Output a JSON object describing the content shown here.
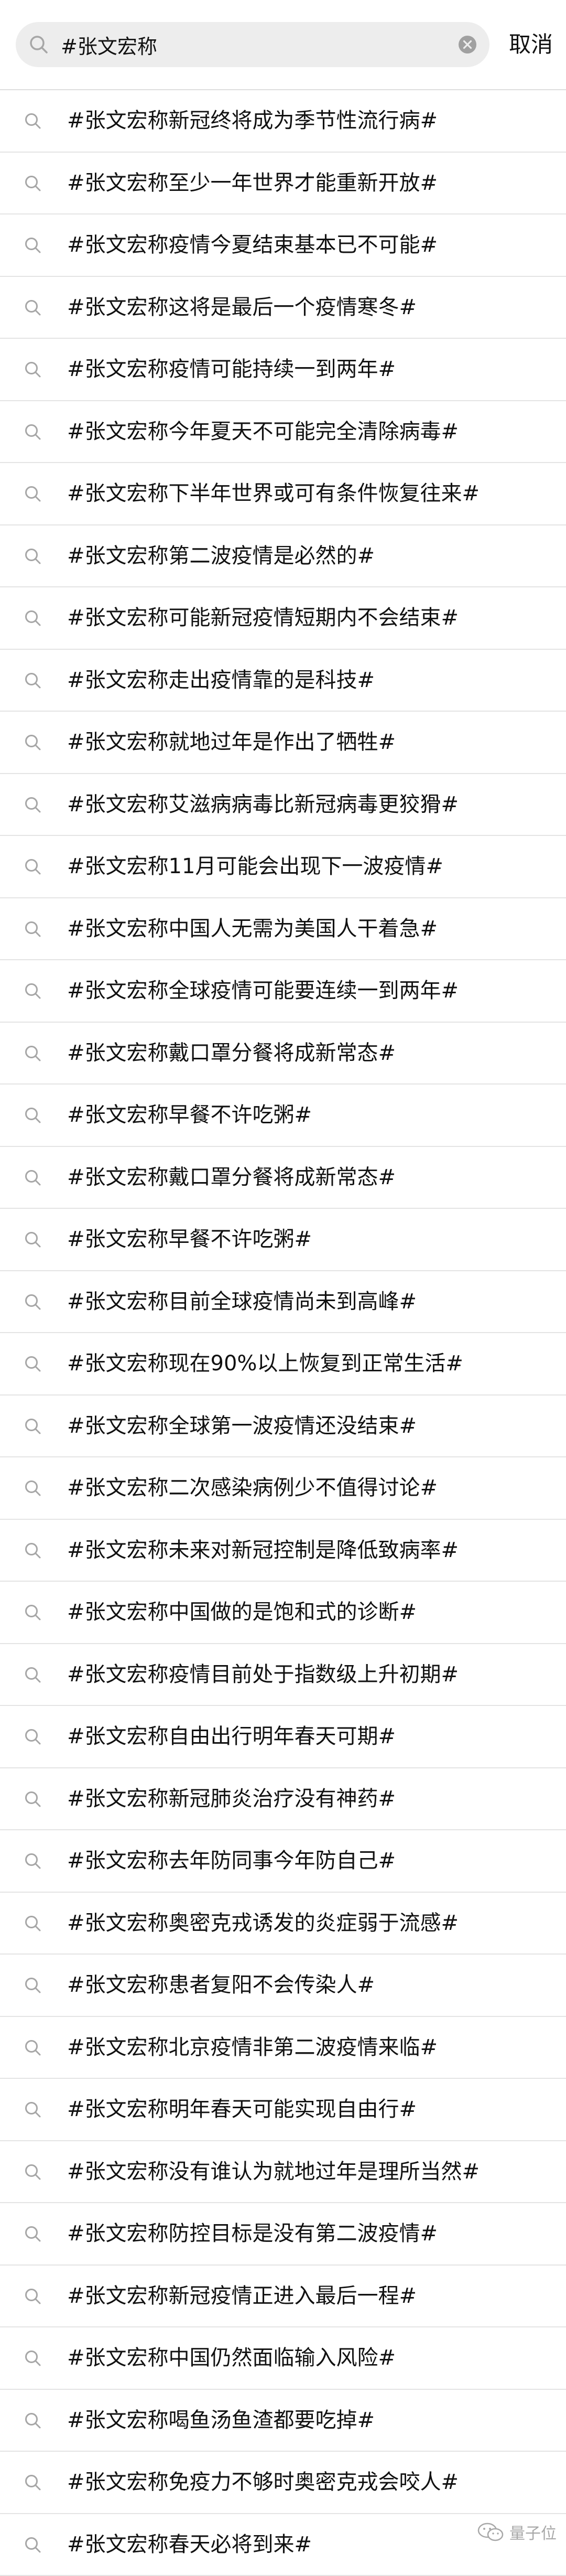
{
  "search": {
    "value": "#张文宏称",
    "cancel_label": "取消"
  },
  "results": [
    "#张文宏称新冠终将成为季节性流行病#",
    "#张文宏称至少一年世界才能重新开放#",
    "#张文宏称疫情今夏结束基本已不可能#",
    "#张文宏称这将是最后一个疫情寒冬#",
    "#张文宏称疫情可能持续一到两年#",
    "#张文宏称今年夏天不可能完全清除病毒#",
    "#张文宏称下半年世界或可有条件恢复往来#",
    "#张文宏称第二波疫情是必然的#",
    "#张文宏称可能新冠疫情短期内不会结束#",
    "#张文宏称走出疫情靠的是科技#",
    "#张文宏称就地过年是作出了牺牲#",
    "#张文宏称艾滋病病毒比新冠病毒更狡猾#",
    "#张文宏称11月可能会出现下一波疫情#",
    "#张文宏称中国人无需为美国人干着急#",
    "#张文宏称全球疫情可能要连续一到两年#",
    "#张文宏称戴口罩分餐将成新常态#",
    "#张文宏称早餐不许吃粥#",
    "#张文宏称戴口罩分餐将成新常态#",
    "#张文宏称早餐不许吃粥#",
    "#张文宏称目前全球疫情尚未到高峰#",
    "#张文宏称现在90%以上恢复到正常生活#",
    "#张文宏称全球第一波疫情还没结束#",
    "#张文宏称二次感染病例少不值得讨论#",
    "#张文宏称未来对新冠控制是降低致病率#",
    "#张文宏称中国做的是饱和式的诊断#",
    "#张文宏称疫情目前处于指数级上升初期#",
    "#张文宏称自由出行明年春天可期#",
    "#张文宏称新冠肺炎治疗没有神药#",
    "#张文宏称去年防同事今年防自己#",
    "#张文宏称奥密克戎诱发的炎症弱于流感#",
    "#张文宏称患者复阳不会传染人#",
    "#张文宏称北京疫情非第二波疫情来临#",
    "#张文宏称明年春天可能实现自由行#",
    "#张文宏称没有谁认为就地过年是理所当然#",
    "#张文宏称防控目标是没有第二波疫情#",
    "#张文宏称新冠疫情正进入最后一程#",
    "#张文宏称中国仍然面临输入风险#",
    "#张文宏称喝鱼汤鱼渣都要吃掉#",
    "#张文宏称免疫力不够时奥密克戎会咬人#",
    "#张文宏称春天必将到来#"
  ],
  "watermark": {
    "text": "量子位"
  },
  "icons": {
    "search": "search-icon",
    "clear": "clear-icon",
    "watermark_logo": "wechat-logo-icon"
  },
  "colors": {
    "search_box_bg": "#ededed",
    "icon_gray": "#a6a6a6",
    "divider": "#e4e4e4",
    "text": "#111111"
  }
}
